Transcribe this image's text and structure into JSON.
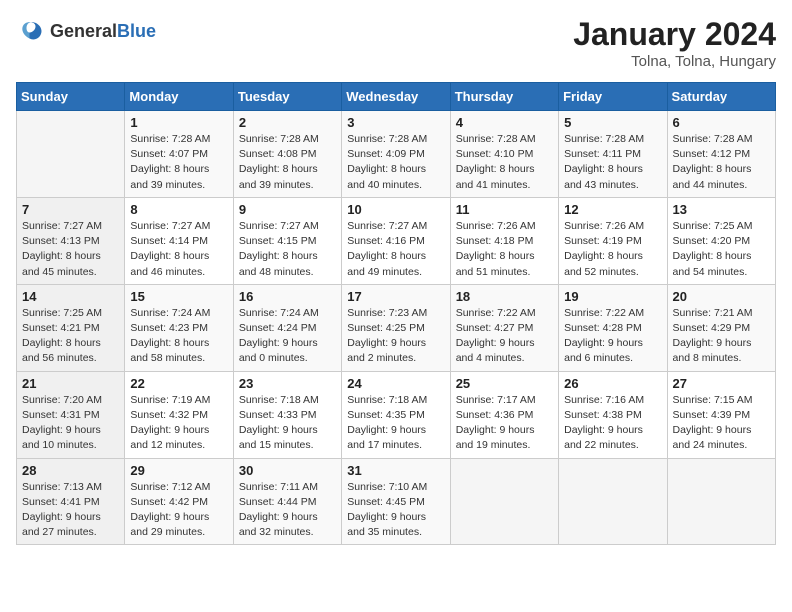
{
  "logo": {
    "text_general": "General",
    "text_blue": "Blue"
  },
  "header": {
    "month": "January 2024",
    "location": "Tolna, Tolna, Hungary"
  },
  "days_of_week": [
    "Sunday",
    "Monday",
    "Tuesday",
    "Wednesday",
    "Thursday",
    "Friday",
    "Saturday"
  ],
  "weeks": [
    [
      {
        "day": "",
        "sunrise": "",
        "sunset": "",
        "daylight": ""
      },
      {
        "day": "1",
        "sunrise": "Sunrise: 7:28 AM",
        "sunset": "Sunset: 4:07 PM",
        "daylight": "Daylight: 8 hours and 39 minutes."
      },
      {
        "day": "2",
        "sunrise": "Sunrise: 7:28 AM",
        "sunset": "Sunset: 4:08 PM",
        "daylight": "Daylight: 8 hours and 39 minutes."
      },
      {
        "day": "3",
        "sunrise": "Sunrise: 7:28 AM",
        "sunset": "Sunset: 4:09 PM",
        "daylight": "Daylight: 8 hours and 40 minutes."
      },
      {
        "day": "4",
        "sunrise": "Sunrise: 7:28 AM",
        "sunset": "Sunset: 4:10 PM",
        "daylight": "Daylight: 8 hours and 41 minutes."
      },
      {
        "day": "5",
        "sunrise": "Sunrise: 7:28 AM",
        "sunset": "Sunset: 4:11 PM",
        "daylight": "Daylight: 8 hours and 43 minutes."
      },
      {
        "day": "6",
        "sunrise": "Sunrise: 7:28 AM",
        "sunset": "Sunset: 4:12 PM",
        "daylight": "Daylight: 8 hours and 44 minutes."
      }
    ],
    [
      {
        "day": "7",
        "sunrise": "Sunrise: 7:27 AM",
        "sunset": "Sunset: 4:13 PM",
        "daylight": "Daylight: 8 hours and 45 minutes."
      },
      {
        "day": "8",
        "sunrise": "Sunrise: 7:27 AM",
        "sunset": "Sunset: 4:14 PM",
        "daylight": "Daylight: 8 hours and 46 minutes."
      },
      {
        "day": "9",
        "sunrise": "Sunrise: 7:27 AM",
        "sunset": "Sunset: 4:15 PM",
        "daylight": "Daylight: 8 hours and 48 minutes."
      },
      {
        "day": "10",
        "sunrise": "Sunrise: 7:27 AM",
        "sunset": "Sunset: 4:16 PM",
        "daylight": "Daylight: 8 hours and 49 minutes."
      },
      {
        "day": "11",
        "sunrise": "Sunrise: 7:26 AM",
        "sunset": "Sunset: 4:18 PM",
        "daylight": "Daylight: 8 hours and 51 minutes."
      },
      {
        "day": "12",
        "sunrise": "Sunrise: 7:26 AM",
        "sunset": "Sunset: 4:19 PM",
        "daylight": "Daylight: 8 hours and 52 minutes."
      },
      {
        "day": "13",
        "sunrise": "Sunrise: 7:25 AM",
        "sunset": "Sunset: 4:20 PM",
        "daylight": "Daylight: 8 hours and 54 minutes."
      }
    ],
    [
      {
        "day": "14",
        "sunrise": "Sunrise: 7:25 AM",
        "sunset": "Sunset: 4:21 PM",
        "daylight": "Daylight: 8 hours and 56 minutes."
      },
      {
        "day": "15",
        "sunrise": "Sunrise: 7:24 AM",
        "sunset": "Sunset: 4:23 PM",
        "daylight": "Daylight: 8 hours and 58 minutes."
      },
      {
        "day": "16",
        "sunrise": "Sunrise: 7:24 AM",
        "sunset": "Sunset: 4:24 PM",
        "daylight": "Daylight: 9 hours and 0 minutes."
      },
      {
        "day": "17",
        "sunrise": "Sunrise: 7:23 AM",
        "sunset": "Sunset: 4:25 PM",
        "daylight": "Daylight: 9 hours and 2 minutes."
      },
      {
        "day": "18",
        "sunrise": "Sunrise: 7:22 AM",
        "sunset": "Sunset: 4:27 PM",
        "daylight": "Daylight: 9 hours and 4 minutes."
      },
      {
        "day": "19",
        "sunrise": "Sunrise: 7:22 AM",
        "sunset": "Sunset: 4:28 PM",
        "daylight": "Daylight: 9 hours and 6 minutes."
      },
      {
        "day": "20",
        "sunrise": "Sunrise: 7:21 AM",
        "sunset": "Sunset: 4:29 PM",
        "daylight": "Daylight: 9 hours and 8 minutes."
      }
    ],
    [
      {
        "day": "21",
        "sunrise": "Sunrise: 7:20 AM",
        "sunset": "Sunset: 4:31 PM",
        "daylight": "Daylight: 9 hours and 10 minutes."
      },
      {
        "day": "22",
        "sunrise": "Sunrise: 7:19 AM",
        "sunset": "Sunset: 4:32 PM",
        "daylight": "Daylight: 9 hours and 12 minutes."
      },
      {
        "day": "23",
        "sunrise": "Sunrise: 7:18 AM",
        "sunset": "Sunset: 4:33 PM",
        "daylight": "Daylight: 9 hours and 15 minutes."
      },
      {
        "day": "24",
        "sunrise": "Sunrise: 7:18 AM",
        "sunset": "Sunset: 4:35 PM",
        "daylight": "Daylight: 9 hours and 17 minutes."
      },
      {
        "day": "25",
        "sunrise": "Sunrise: 7:17 AM",
        "sunset": "Sunset: 4:36 PM",
        "daylight": "Daylight: 9 hours and 19 minutes."
      },
      {
        "day": "26",
        "sunrise": "Sunrise: 7:16 AM",
        "sunset": "Sunset: 4:38 PM",
        "daylight": "Daylight: 9 hours and 22 minutes."
      },
      {
        "day": "27",
        "sunrise": "Sunrise: 7:15 AM",
        "sunset": "Sunset: 4:39 PM",
        "daylight": "Daylight: 9 hours and 24 minutes."
      }
    ],
    [
      {
        "day": "28",
        "sunrise": "Sunrise: 7:13 AM",
        "sunset": "Sunset: 4:41 PM",
        "daylight": "Daylight: 9 hours and 27 minutes."
      },
      {
        "day": "29",
        "sunrise": "Sunrise: 7:12 AM",
        "sunset": "Sunset: 4:42 PM",
        "daylight": "Daylight: 9 hours and 29 minutes."
      },
      {
        "day": "30",
        "sunrise": "Sunrise: 7:11 AM",
        "sunset": "Sunset: 4:44 PM",
        "daylight": "Daylight: 9 hours and 32 minutes."
      },
      {
        "day": "31",
        "sunrise": "Sunrise: 7:10 AM",
        "sunset": "Sunset: 4:45 PM",
        "daylight": "Daylight: 9 hours and 35 minutes."
      },
      {
        "day": "",
        "sunrise": "",
        "sunset": "",
        "daylight": ""
      },
      {
        "day": "",
        "sunrise": "",
        "sunset": "",
        "daylight": ""
      },
      {
        "day": "",
        "sunrise": "",
        "sunset": "",
        "daylight": ""
      }
    ]
  ]
}
